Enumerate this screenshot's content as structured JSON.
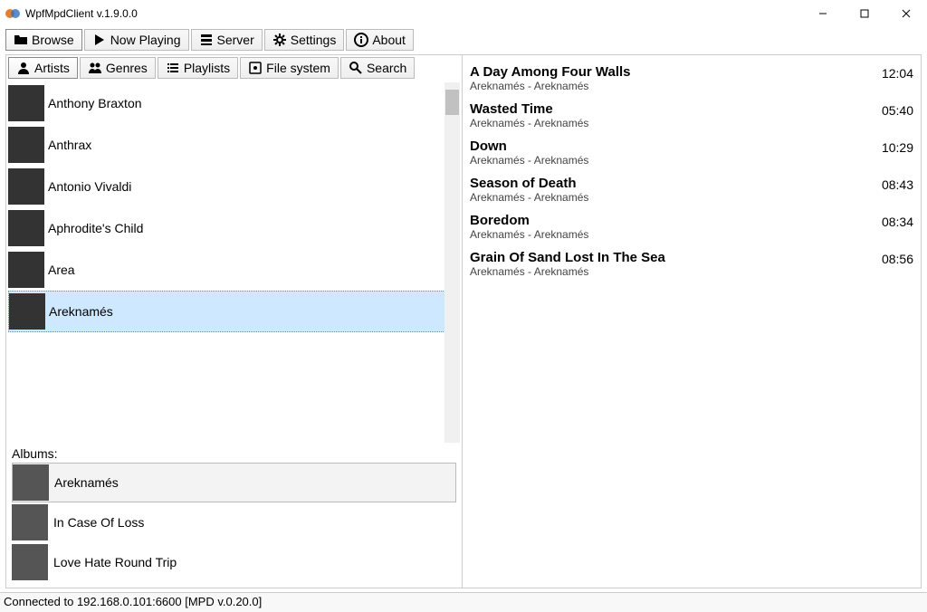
{
  "window": {
    "title": "WpfMpdClient v.1.9.0.0"
  },
  "toolbar": {
    "browse": "Browse",
    "now_playing": "Now Playing",
    "server": "Server",
    "settings": "Settings",
    "about": "About"
  },
  "subtoolbar": {
    "artists": "Artists",
    "genres": "Genres",
    "playlists": "Playlists",
    "file_system": "File system",
    "search": "Search"
  },
  "artists": [
    {
      "name": "Anthony Braxton",
      "selected": false,
      "thumb": "th-a"
    },
    {
      "name": "Anthrax",
      "selected": false,
      "thumb": "th-b"
    },
    {
      "name": "Antonio Vivaldi",
      "selected": false,
      "thumb": "th-c"
    },
    {
      "name": "Aphrodite's Child",
      "selected": false,
      "thumb": "th-d"
    },
    {
      "name": "Area",
      "selected": false,
      "thumb": "th-e"
    },
    {
      "name": "Areknamés",
      "selected": true,
      "thumb": "th-f"
    }
  ],
  "albums_label": "Albums:",
  "albums": [
    {
      "name": "Areknamés",
      "selected": true,
      "thumb": "th-g"
    },
    {
      "name": "In Case Of Loss",
      "selected": false,
      "thumb": "th-h"
    },
    {
      "name": "Love Hate Round Trip",
      "selected": false,
      "thumb": "th-i"
    }
  ],
  "tracks": [
    {
      "title": "A Day Among Four Walls",
      "artist": "Areknamés - Areknamés",
      "duration": "12:04"
    },
    {
      "title": "Wasted Time",
      "artist": "Areknamés - Areknamés",
      "duration": "05:40"
    },
    {
      "title": "Down",
      "artist": "Areknamés - Areknamés",
      "duration": "10:29"
    },
    {
      "title": "Season of Death",
      "artist": "Areknamés - Areknamés",
      "duration": "08:43"
    },
    {
      "title": "Boredom",
      "artist": "Areknamés - Areknamés",
      "duration": "08:34"
    },
    {
      "title": "Grain Of Sand Lost In The Sea",
      "artist": "Areknamés - Areknamés",
      "duration": "08:56"
    }
  ],
  "status": "Connected to 192.168.0.101:6600 [MPD v.0.20.0]"
}
